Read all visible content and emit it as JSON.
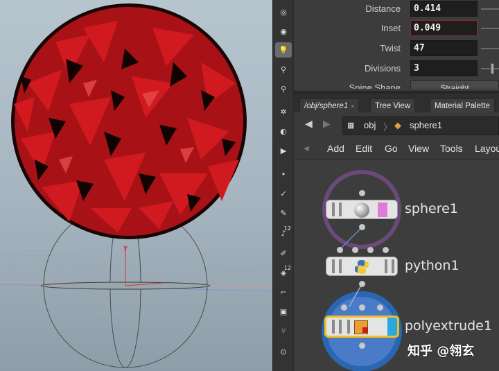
{
  "parameters": [
    {
      "label": "Distance",
      "value": "0.414"
    },
    {
      "label": "Inset",
      "value": "0.049"
    },
    {
      "label": "Twist",
      "value": "47"
    },
    {
      "label": "Divisions",
      "value": "3"
    },
    {
      "label": "Spine Shape",
      "value": "Straight"
    }
  ],
  "tabs": [
    {
      "label": "/obj/sphere1",
      "close": "×"
    },
    {
      "label": "Tree View"
    },
    {
      "label": "Material Palette"
    }
  ],
  "path": {
    "level1": "obj",
    "level2": "sphere1"
  },
  "menu": [
    "Add",
    "Edit",
    "Go",
    "View",
    "Tools",
    "Layout"
  ],
  "nodes": [
    {
      "name": "sphere1"
    },
    {
      "name": "python1"
    },
    {
      "name": "polyextrude1"
    }
  ],
  "shelf": {
    "numbers": [
      "12",
      "12"
    ]
  },
  "viewport": {
    "axis_label": "y"
  },
  "watermark": "知乎 @翎玄",
  "colors": {
    "accent_selected": "#f0c020",
    "display_flag": "#29a9e0",
    "template_flag": "#e07ad8",
    "sphere_red": "#c8161c"
  }
}
